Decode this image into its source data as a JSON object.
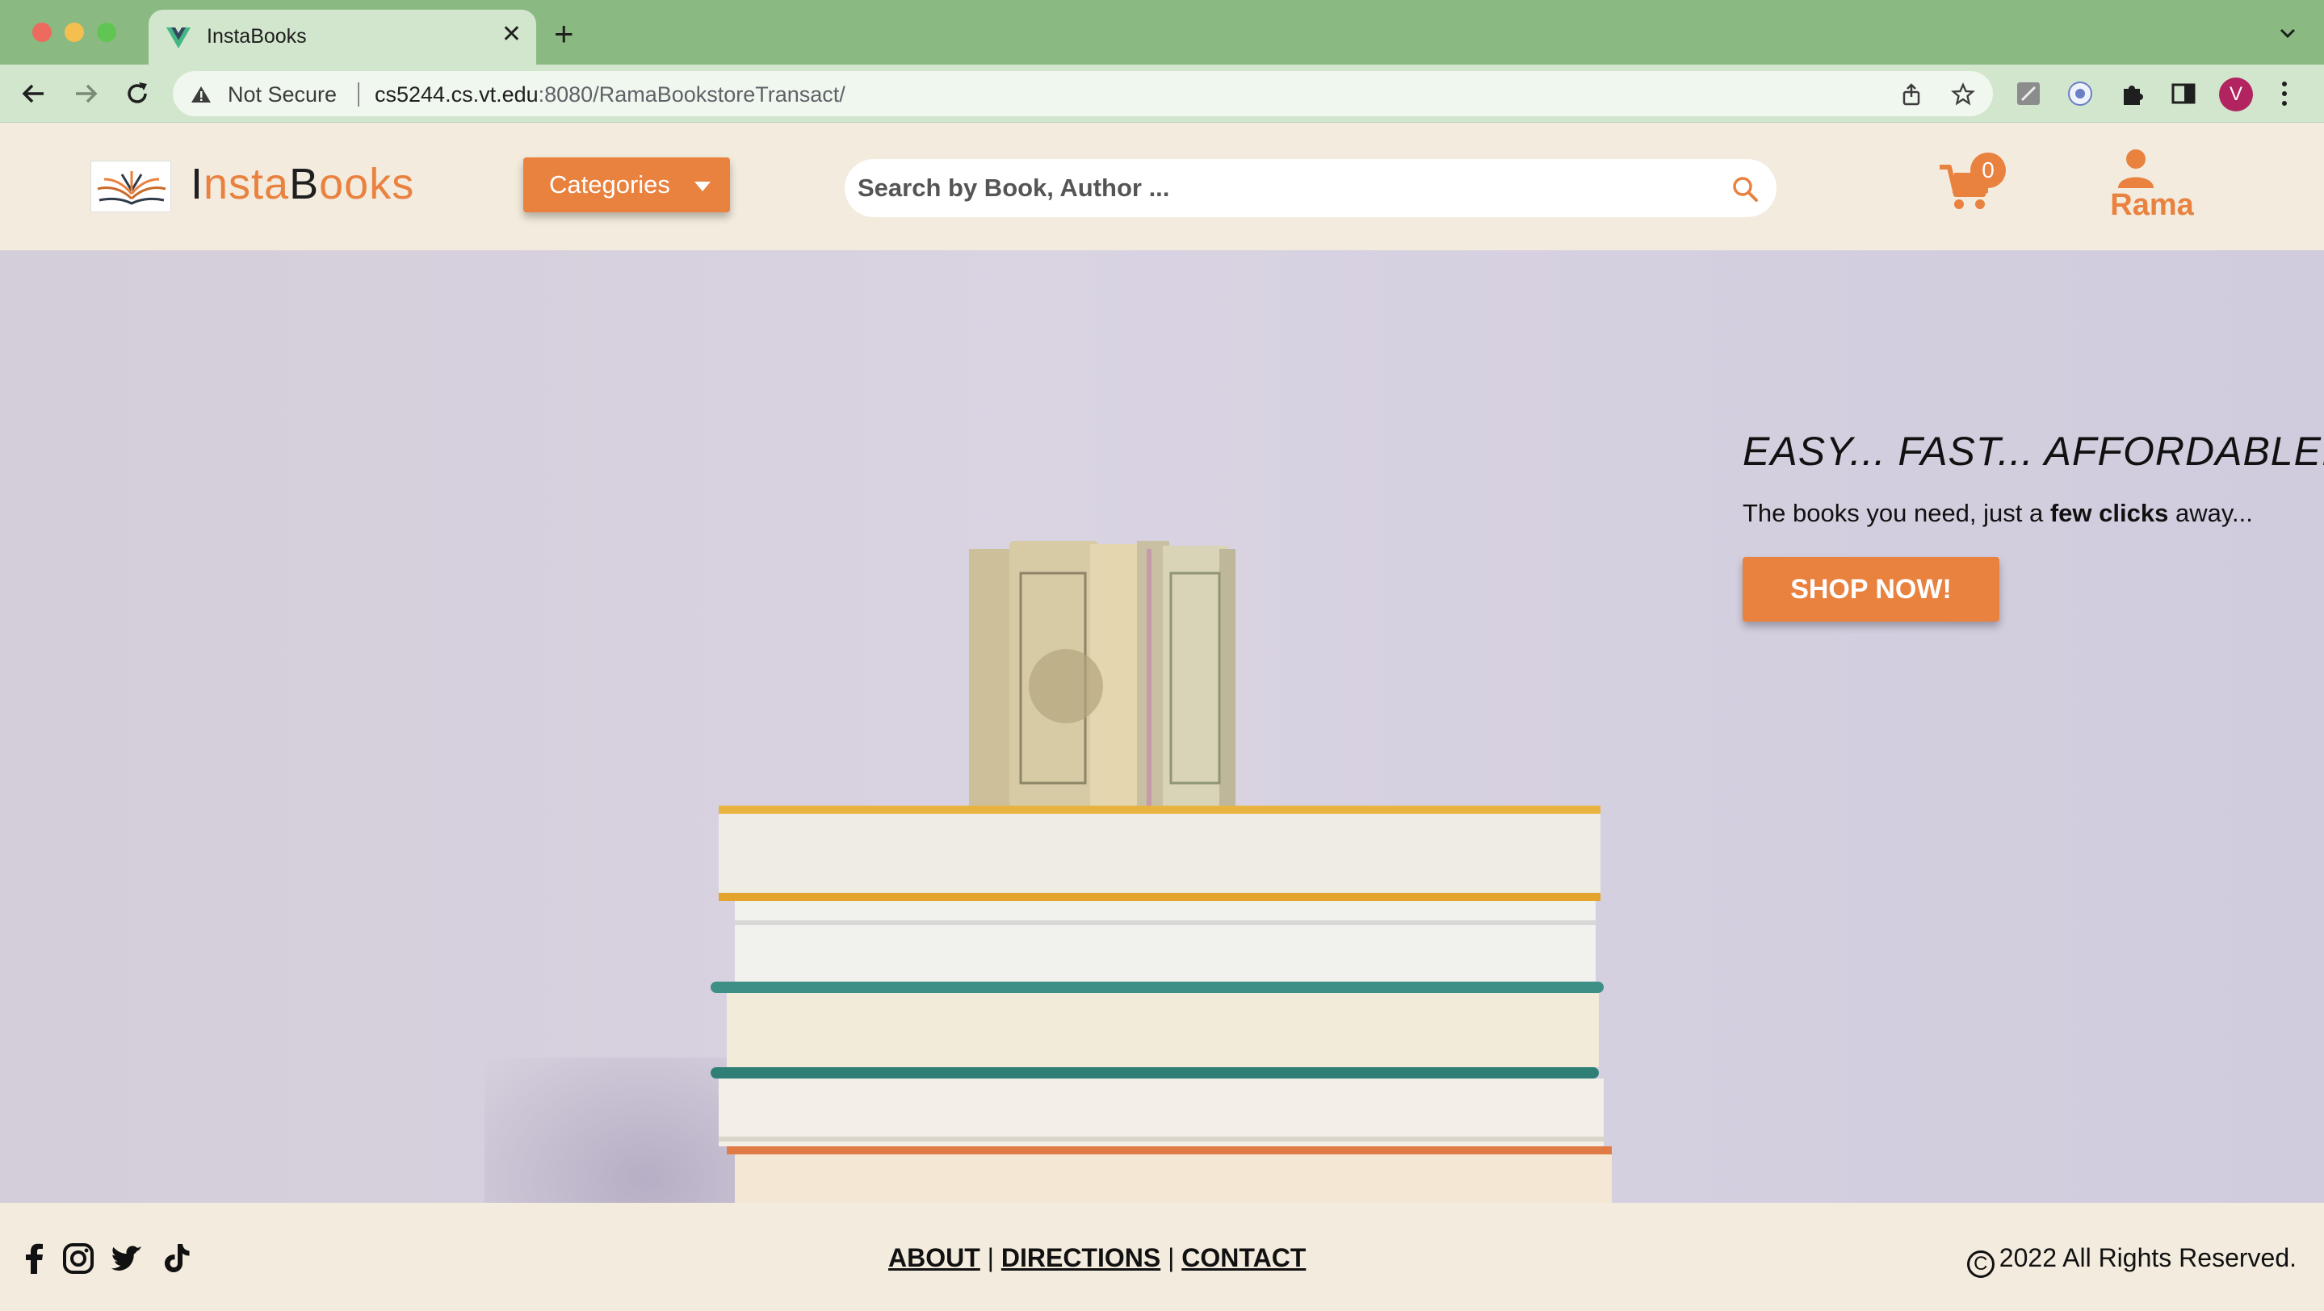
{
  "browser": {
    "tab_title": "InstaBooks",
    "new_tab_label": "+",
    "close_label": "✕",
    "security_label": "Not Secure",
    "url_host": "cs5244.cs.vt.edu",
    "url_rest": ":8080/RamaBookstoreTransact/",
    "profile_initial": "V"
  },
  "header": {
    "logo_dark_i": "I",
    "logo_orange_1": "nsta",
    "logo_dark_b": "B",
    "logo_orange_2": "ooks",
    "categories_label": "Categories",
    "search_placeholder": "Search by Book, Author ...",
    "cart_count": "0",
    "user_name": "Rama"
  },
  "hero": {
    "tagline": "EASY... FAST... AFFORDABLE...",
    "subtitle_start": "The books you need, just a ",
    "subtitle_bold": "few clicks",
    "subtitle_end": " away...",
    "cta_label": "SHOP NOW!"
  },
  "footer": {
    "links": [
      "ABOUT",
      "DIRECTIONS",
      "CONTACT"
    ],
    "separator": "|",
    "copyright_symbol": "C",
    "copyright_text": "2022 All Rights Reserved."
  },
  "icons": {
    "social": [
      "facebook-icon",
      "instagram-icon",
      "twitter-icon",
      "tiktok-icon"
    ]
  },
  "colors": {
    "accent": "#e9813f",
    "browser_frame": "#8aba82",
    "page_bg": "#f3ebdd",
    "hero_bg": "#d6d0de"
  }
}
